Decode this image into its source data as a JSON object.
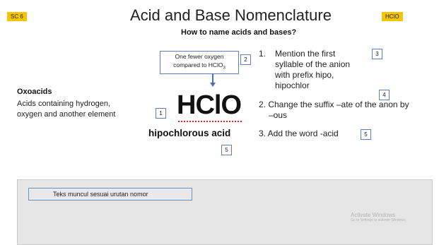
{
  "slide": {
    "code_tag": "SC 6",
    "title": "Acid and Base Nomenclature",
    "formula_tag": "HClO",
    "subtitle": "How to name acids and bases?",
    "callout": {
      "line1": "One fewer oxygen",
      "line2_prefix": "compared to HClO",
      "line2_sub": "3"
    },
    "oxoacids": {
      "heading": "Oxoacids",
      "line1": "Acids containing hydrogen,",
      "line2": "oxygen and another element"
    },
    "formula": "HClO",
    "acid_name": "hipochlorous acid",
    "steps": {
      "step1": {
        "number": "1.",
        "l1": "Mention the first",
        "l2": "syllable of the anion",
        "l3": "with prefix hipo,",
        "l4": "hipochlor"
      },
      "step2": {
        "l1": "2. Change the suffix –ate of the anon by",
        "l2": "–ous"
      },
      "step3": {
        "l1": "3. Add the word -acid"
      }
    },
    "number_boxes": {
      "b1": "1",
      "b2": "2",
      "b3": "3",
      "b4": "4",
      "b5a": "5",
      "b5b": "5"
    }
  },
  "panel": {
    "label": "Teks muncul sesuai urutan nomor"
  },
  "watermark": {
    "line1": "Activate Windows",
    "line2": "Go to Settings to activate Windows."
  },
  "colors": {
    "tag": "#f5c400",
    "accent_blue": "#4a6fbe",
    "panel_bg": "#e6e6e6"
  }
}
